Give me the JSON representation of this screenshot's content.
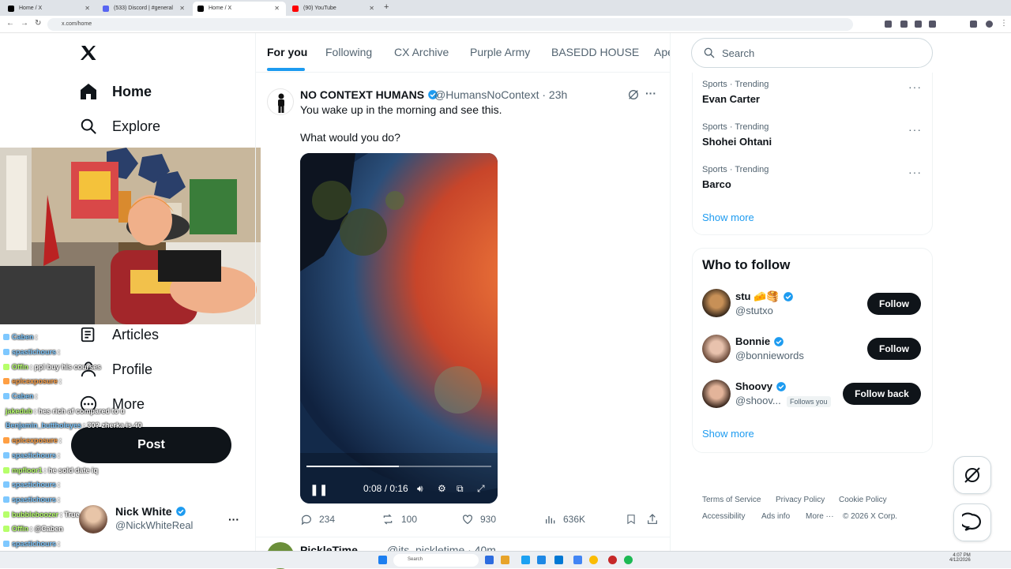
{
  "browser": {
    "tabs": [
      {
        "label": "Home / X",
        "favicon_color": "#000000"
      },
      {
        "label": "(533) Discord | #general",
        "favicon_color": "#5865F2"
      },
      {
        "label": "Home / X",
        "favicon_color": "#000000"
      },
      {
        "label": "(90) YouTube",
        "favicon_color": "#FF0000"
      }
    ],
    "url": "x.com/home"
  },
  "sidebar": {
    "items": [
      {
        "label": "Home",
        "icon": "home-icon"
      },
      {
        "label": "Explore",
        "icon": "search-icon"
      },
      {
        "label": "Articles",
        "icon": "articles-icon"
      },
      {
        "label": "Profile",
        "icon": "profile-icon"
      },
      {
        "label": "More",
        "icon": "more-circle-icon"
      }
    ],
    "post_label": "Post",
    "user": {
      "name": "Nick White",
      "handle": "@NickWhiteReal"
    }
  },
  "stream_chat": [
    {
      "user": "Caben",
      "msg": ":",
      "color": "#7ec8ff"
    },
    {
      "user": "spastichours",
      "msg": ":",
      "color": "#7ec8ff"
    },
    {
      "user": "Offin",
      "msg": ": ppl buy his courses",
      "color": "#b6ff6a"
    },
    {
      "user": "epicexposure",
      "msg": ":",
      "color": "#ff9f43"
    },
    {
      "user": "Caben",
      "msg": ":",
      "color": "#7ec8ff"
    },
    {
      "user": "jakedub",
      "msg": ": hes rich af compared to u",
      "color": "#b6ff6a"
    },
    {
      "user": "Benjamin_buttholeyes",
      "msg": ": 30? zherka is 40",
      "color": "#7ec8ff"
    },
    {
      "user": "epicexposure",
      "msg": ":",
      "color": "#ff9f43"
    },
    {
      "user": "spastichours",
      "msg": ":",
      "color": "#7ec8ff"
    },
    {
      "user": "mpfloor1",
      "msg": ": he sold date iq",
      "color": "#b6ff6a"
    },
    {
      "user": "spastichours",
      "msg": ":",
      "color": "#7ec8ff"
    },
    {
      "user": "spastichours",
      "msg": ":",
      "color": "#7ec8ff"
    },
    {
      "user": "bubbleboozer",
      "msg": ": True",
      "color": "#b6ff6a"
    },
    {
      "user": "Offin",
      "msg": ": @Caben",
      "color": "#b6ff6a"
    },
    {
      "user": "spastichours",
      "msg": ":",
      "color": "#7ec8ff"
    }
  ],
  "feed": {
    "tabs": [
      "For you",
      "Following",
      "CX Archive",
      "Purple Army",
      "BASEDD HOUSE",
      "Ape"
    ],
    "tweet": {
      "name": "NO CONTEXT HUMANS",
      "handle": "@HumansNoContext · 23h",
      "line1": "You wake up in the morning and see this.",
      "line2": "What would you do?",
      "video_time": "0:08 / 0:16",
      "video_progress": 0.5,
      "replies": "234",
      "reposts": "100",
      "likes": "930",
      "views": "636K"
    },
    "next_tweet": {
      "name": "PickleTime",
      "handle": "@its_pickletime · 40m"
    }
  },
  "right": {
    "search_placeholder": "Search",
    "trending": [
      {
        "category": "Sports · Trending",
        "name": "Evan Carter"
      },
      {
        "category": "Sports · Trending",
        "name": "Shohei Ohtani"
      },
      {
        "category": "Sports · Trending",
        "name": "Barco"
      }
    ],
    "show_more": "Show more",
    "who_to_follow_title": "Who to follow",
    "follow": [
      {
        "name": "stu 🧀🥞",
        "handle": "@stutxo",
        "button": "Follow"
      },
      {
        "name": "Bonnie",
        "handle": "@bonniewords",
        "button": "Follow"
      },
      {
        "name": "Shoovy",
        "handle": "@shoov...",
        "button": "Follow back",
        "follows_you": "Follows you"
      }
    ],
    "footer": [
      "Terms of Service",
      "Privacy Policy",
      "Cookie Policy",
      "Accessibility",
      "Ads info",
      "More ···",
      "© 2026 X Corp."
    ]
  },
  "taskbar": {
    "search": "Search",
    "time": "4:07 PM",
    "date": "4/12/2026"
  },
  "colors": {
    "accent": "#1d9bf0",
    "text": "#0f1419",
    "muted": "#536471"
  }
}
